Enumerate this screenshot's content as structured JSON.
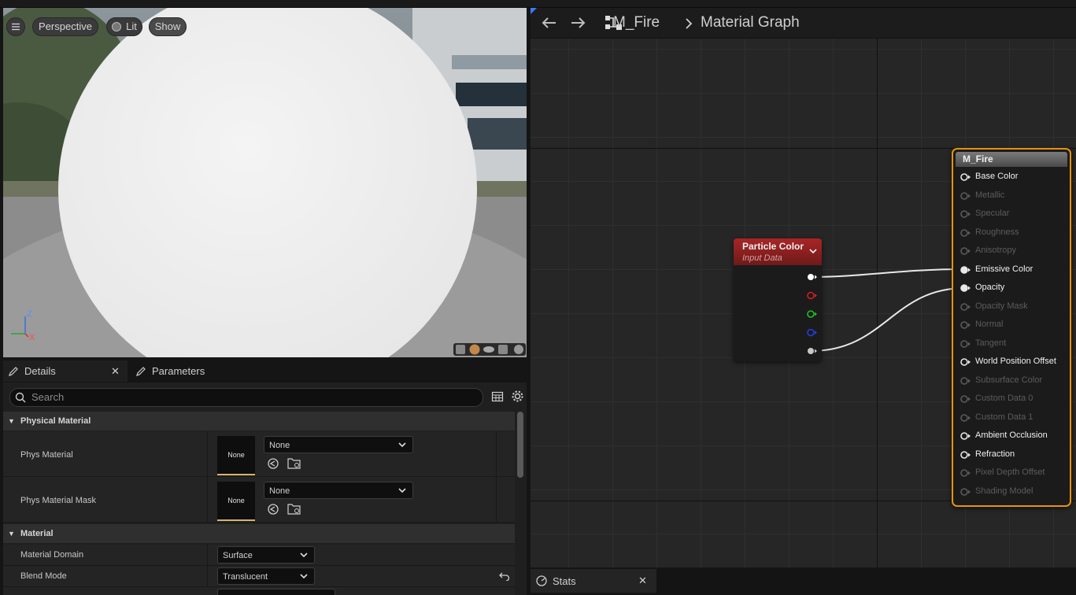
{
  "viewport": {
    "menu_icon": "hamburger-icon",
    "perspective_label": "Perspective",
    "lit_label": "Lit",
    "show_label": "Show",
    "axis_z": "Z",
    "axis_x": "X"
  },
  "details_panel": {
    "tabs": [
      {
        "label": "Details",
        "icon": "pencil-icon"
      },
      {
        "label": "Parameters",
        "icon": "pencil-icon"
      }
    ],
    "search_placeholder": "Search",
    "sections": {
      "physical_material": {
        "title": "Physical Material",
        "rows": [
          {
            "label": "Phys Material",
            "thumb": "None",
            "value": "None"
          },
          {
            "label": "Phys Material Mask",
            "thumb": "None",
            "value": "None"
          }
        ]
      },
      "material": {
        "title": "Material",
        "rows": [
          {
            "label": "Material Domain",
            "value": "Surface"
          },
          {
            "label": "Blend Mode",
            "value": "Translucent"
          }
        ]
      }
    }
  },
  "graph": {
    "breadcrumb_root": "M_Fire",
    "breadcrumb_leaf": "Material Graph",
    "particle_node": {
      "title": "Particle Color",
      "subtitle": "Input Data",
      "pin_colors": [
        "#ffffff",
        "#d02020",
        "#20c020",
        "#2040e0",
        "#c8c8c8"
      ]
    },
    "output_node": {
      "title": "M_Fire",
      "pins": [
        {
          "label": "Base Color",
          "active": true
        },
        {
          "label": "Metallic",
          "active": false
        },
        {
          "label": "Specular",
          "active": false
        },
        {
          "label": "Roughness",
          "active": false
        },
        {
          "label": "Anisotropy",
          "active": false
        },
        {
          "label": "Emissive Color",
          "active": true
        },
        {
          "label": "Opacity",
          "active": true
        },
        {
          "label": "Opacity Mask",
          "active": false
        },
        {
          "label": "Normal",
          "active": false
        },
        {
          "label": "Tangent",
          "active": false
        },
        {
          "label": "World Position Offset",
          "active": true
        },
        {
          "label": "Subsurface Color",
          "active": false
        },
        {
          "label": "Custom Data 0",
          "active": false
        },
        {
          "label": "Custom Data 1",
          "active": false
        },
        {
          "label": "Ambient Occlusion",
          "active": true
        },
        {
          "label": "Refraction",
          "active": true
        },
        {
          "label": "Pixel Depth Offset",
          "active": false
        },
        {
          "label": "Shading Model",
          "active": false
        }
      ]
    }
  },
  "stats_tab": {
    "label": "Stats"
  },
  "colors": {
    "selection": "#e8940a",
    "particle_header": "#8a1f1f"
  }
}
